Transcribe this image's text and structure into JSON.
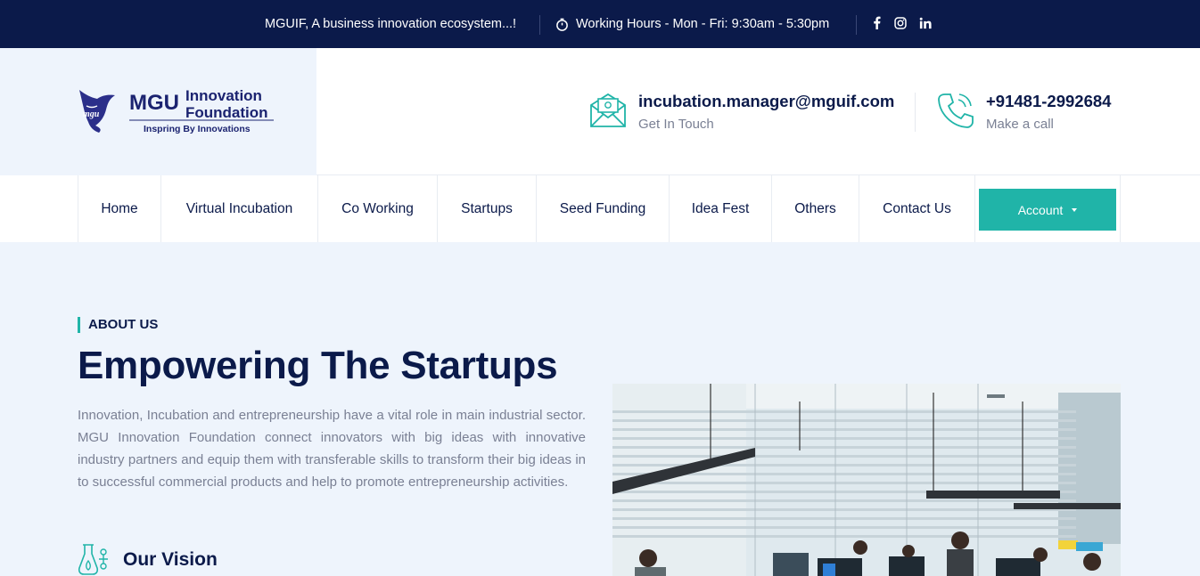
{
  "topbar": {
    "tagline": "MGUIF, A business innovation ecosystem...!",
    "hours": "Working Hours - Mon - Fri: 9:30am - 5:30pm",
    "icons": [
      "clock-icon",
      "facebook-icon",
      "instagram-icon",
      "linkedin-icon"
    ]
  },
  "logo": {
    "mark": "MGU",
    "line1": "Innovation",
    "line2": "Foundation",
    "tagline": "Inspring By Innovations"
  },
  "contact": {
    "email": "incubation.manager@mguif.com",
    "email_sub": "Get In Touch",
    "phone": "+91481-2992684",
    "phone_sub": "Make a call"
  },
  "nav": {
    "items": [
      {
        "label": "Home"
      },
      {
        "label": "Virtual Incubation"
      },
      {
        "label": "Co Working"
      },
      {
        "label": "Startups"
      },
      {
        "label": "Seed Funding"
      },
      {
        "label": "Idea Fest"
      },
      {
        "label": "Others"
      },
      {
        "label": "Contact Us"
      }
    ],
    "account": "Account"
  },
  "about": {
    "label": "ABOUT US",
    "title": "Empowering The Startups",
    "text": "Innovation, Incubation and entrepreneurship have a vital role in main industrial sector. MGU Innovation Foundation connect innovators with big ideas with innovative industry partners and equip them with transferable skills to transform their big ideas in to successful commercial products and help to promote entrepreneurship activities.",
    "vision_title": "Our Vision"
  },
  "colors": {
    "navy": "#0b1a4a",
    "teal": "#20b4a8",
    "background": "#eef4fc"
  }
}
